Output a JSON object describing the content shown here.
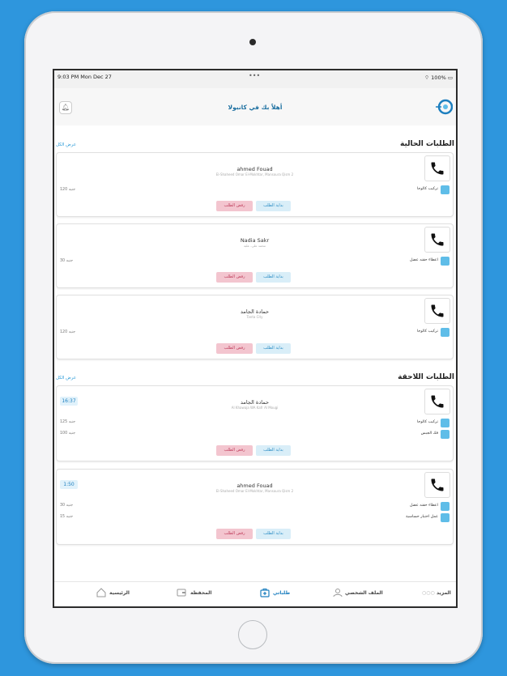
{
  "status_bar": {
    "time": "9:03 PM  Mon Dec 27",
    "dots": "•••",
    "battery": "100%"
  },
  "header": {
    "title": "أهلاً بك في كانبولا"
  },
  "sections": {
    "current": {
      "title": "الطلبات الحالية",
      "show_all": "عرض الكل"
    },
    "upcoming": {
      "title": "الطلبات اللاحقة",
      "show_all": "عرض الكل"
    }
  },
  "buttons": {
    "start": "بداية الطلب",
    "reject": "رفض الطلب"
  },
  "current_orders": [
    {
      "name": "ahmed Fouad",
      "address": "El-Shaheed Omar El-Mokhtar, Mansoura Qism 2",
      "services": [
        {
          "label": "تركيب كالوجا",
          "price": "120 جنيه"
        }
      ]
    },
    {
      "name": "Nadia Sakr",
      "address": "محمد على، علبة",
      "services": [
        {
          "label": "اعطاء حقنه عضل",
          "price": "30 جنيه"
        }
      ]
    },
    {
      "name": "حمادة الجامد",
      "address": "Tanta City",
      "services": [
        {
          "label": "تركيب كالوجا",
          "price": "120 جنيه"
        }
      ]
    }
  ],
  "upcoming_orders": [
    {
      "name": "حمادة الجامد",
      "address": "Al Khawaja WA Kafr Al Mougi",
      "timer": "16:37",
      "services": [
        {
          "label": "تركيب كالوجا",
          "price": "125 جنيه"
        },
        {
          "label": "فك الجبس",
          "price": "100 جنيه"
        }
      ]
    },
    {
      "name": "ahmed Fouad",
      "address": "El-Shaheed Omar El-Mokhtar, Mansoura Qism 2",
      "timer": "1:50",
      "services": [
        {
          "label": "اعطاء حقنه عضل",
          "price": "30 جنيه"
        },
        {
          "label": "عمل اختبار حساسية",
          "price": "15 جنيه"
        }
      ]
    }
  ],
  "tabbar": {
    "home": "الرئيسية",
    "wallet": "المحفظة",
    "orders": "طلباتي",
    "profile": "الملف الشخصي",
    "more": "المزيد"
  },
  "colors": {
    "accent": "#1d7fbf",
    "reject": "#f3c5cf",
    "start": "#d9eef8",
    "background": "#2e96dd"
  }
}
